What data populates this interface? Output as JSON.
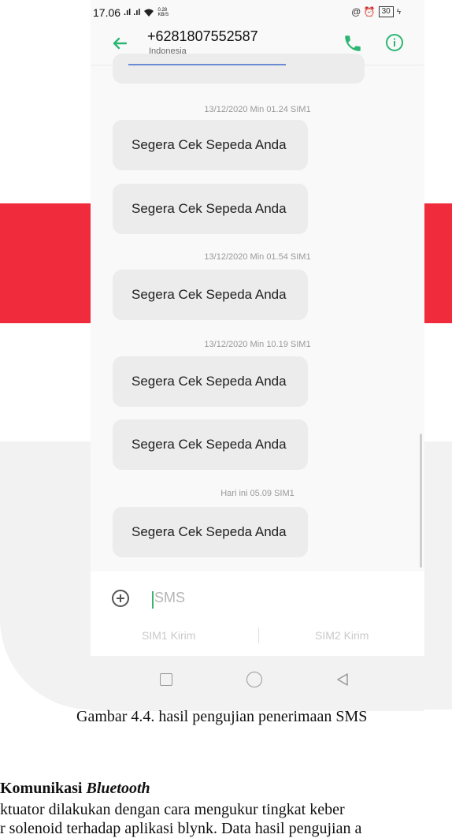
{
  "status_bar": {
    "time": "17.06",
    "signal_text": ".ıl .ıl",
    "speed": "0.28",
    "speed_unit": "KB/S",
    "right_icons": "@ ⏰",
    "battery": "30"
  },
  "header": {
    "contact_number": "+6281807552587",
    "contact_country": "Indonesia"
  },
  "messages": [
    {
      "timestamp": "13/12/2020 Min 01.24  SIM1",
      "text": "Segera Cek Sepeda Anda"
    },
    {
      "timestamp": "",
      "text": "Segera Cek Sepeda Anda"
    },
    {
      "timestamp": "13/12/2020 Min 01.54  SIM1",
      "text": "Segera Cek Sepeda Anda"
    },
    {
      "timestamp": "13/12/2020 Min 10.19  SIM1",
      "text": "Segera Cek Sepeda Anda"
    },
    {
      "timestamp": "",
      "text": "Segera Cek Sepeda Anda"
    },
    {
      "timestamp": "Hari ini 05.09  SIM1",
      "text": "Segera Cek Sepeda Anda"
    }
  ],
  "compose": {
    "placeholder": "SMS",
    "send_sim1": "SIM1 Kirim",
    "send_sim2": "SIM2 Kirim"
  },
  "document": {
    "caption": "Gambar 4.4. hasil pengujian penerimaan SMS",
    "section_heading_prefix": "Komunikasi ",
    "section_heading_italic": "Bluetooth",
    "body_line_1": "ktuator dilakukan dengan cara mengukur tingkat keber",
    "body_line_2": "r solenoid terhadap aplikasi blynk. Data hasil pengujian a"
  },
  "colors": {
    "watermark_red": "#ef2b3c",
    "accent_green": "#2bb673",
    "bubble_gray": "#ececec"
  }
}
